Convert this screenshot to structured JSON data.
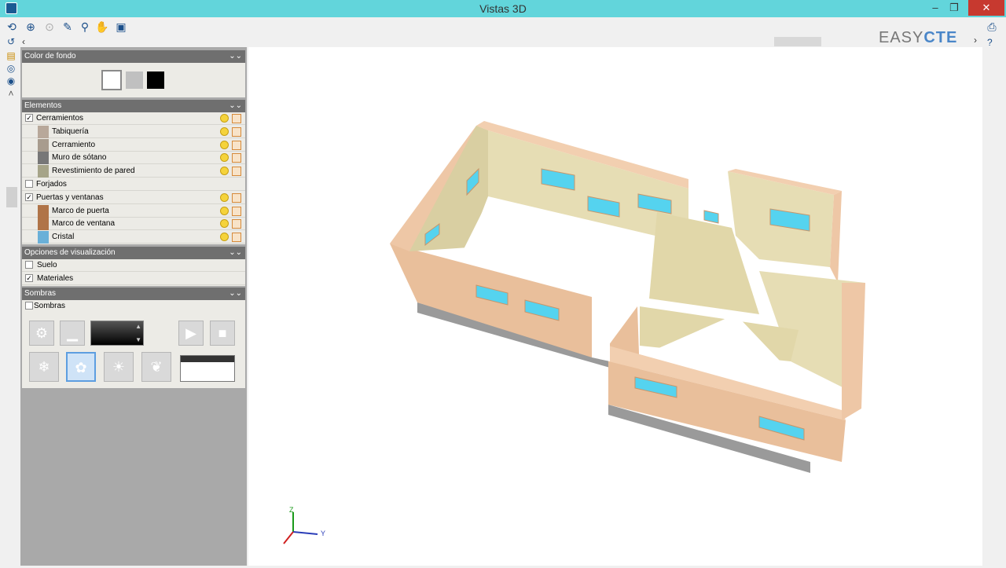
{
  "window": {
    "title": "Vistas 3D"
  },
  "brand": {
    "easy": "EASY",
    "cte": "CTE"
  },
  "panel": {
    "background_section": {
      "title": "Color de fondo",
      "swatches": [
        "#ffffff",
        "#c0c0c0",
        "#000000"
      ],
      "selected": "#ffffff"
    },
    "elements_section": {
      "title": "Elementos",
      "rows": [
        {
          "label": "Cerramientos",
          "checked": true,
          "level": 0,
          "color": null
        },
        {
          "label": "Tabiquería",
          "level": 1,
          "color": "#b8a89a"
        },
        {
          "label": "Cerramiento",
          "level": 1,
          "color": "#a89c8e"
        },
        {
          "label": "Muro de sótano",
          "level": 1,
          "color": "#777777"
        },
        {
          "label": "Revestimiento de pared",
          "level": 1,
          "color": "#a6a488"
        },
        {
          "label": "Forjados",
          "checked": false,
          "level": 0,
          "color": null
        },
        {
          "label": "Puertas y ventanas",
          "checked": true,
          "level": 0,
          "color": null
        },
        {
          "label": "Marco de puerta",
          "level": 1,
          "color": "#b07448"
        },
        {
          "label": "Marco de ventana",
          "level": 1,
          "color": "#b07448"
        },
        {
          "label": "Cristal",
          "level": 1,
          "color": "#6ab0d8"
        }
      ]
    },
    "view_options_section": {
      "title": "Opciones de visualización",
      "options": [
        {
          "label": "Suelo",
          "checked": false
        },
        {
          "label": "Materiales",
          "checked": true
        }
      ]
    },
    "shadows_section": {
      "title": "Sombras",
      "option": {
        "label": "Sombras",
        "checked": false
      }
    }
  },
  "axes": {
    "z": "Z",
    "y": "Y",
    "x": "X"
  },
  "colors": {
    "titlebar": "#62d5db",
    "wall_outer": "#e9bf9b",
    "wall_inner": "#e6ddb4",
    "glass": "#55d3ef",
    "base": "#9a9a9a"
  }
}
